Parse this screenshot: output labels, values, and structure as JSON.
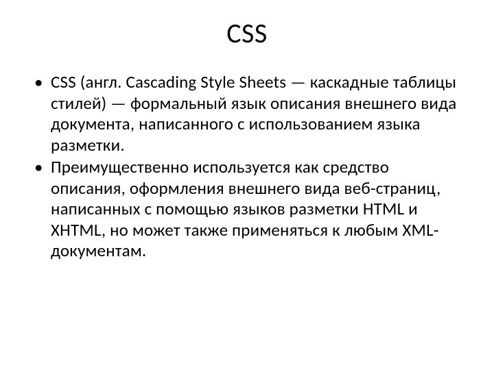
{
  "title": "CSS",
  "bullets": [
    "CSS (англ. Cascading Style Sheets — каскадные таблицы стилей) — формальный язык описания внешнего вида документа, написанного с использованием языка разметки.",
    "Преимущественно используется как средство описания, оформления внешнего вида веб-страниц, написанных с помощью языков разметки HTML и XHTML, но может также применяться к любым XML-документам."
  ]
}
